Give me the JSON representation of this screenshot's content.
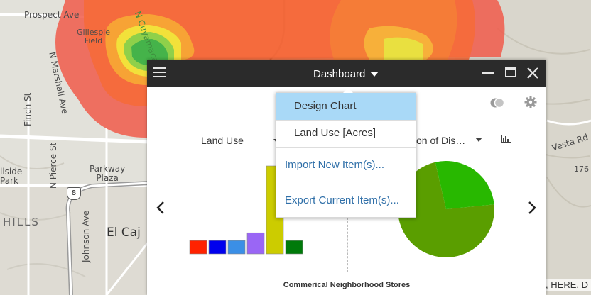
{
  "map": {
    "roads": {
      "prospect_ave": "Prospect Ave",
      "gillespie_field": "Gillespie\nField",
      "n_marshall_ave": "N Marshall Ave",
      "n_cuyamaca_st": "N Cuyamaca St",
      "finch_st": "Finch St",
      "n_pierce_st": "N Pierce St",
      "johnson_ave": "Johnson Ave",
      "parkway_plaza": "Parkway\nPlaza",
      "vesta_rd": "Vesta Rd",
      "hillside_park": "llside\nPark",
      "highway_8": "8",
      "number_176": "176"
    },
    "towns": {
      "hills": "HILLS",
      "el_cajon": "El Caj"
    },
    "attribution": ", HERE, D"
  },
  "dashboard": {
    "title": "Dashboard",
    "charts": {
      "left_title": "Land Use",
      "right_title": "on of Dis…",
      "footer": "Commerical Neighborhood Stores"
    },
    "menu": {
      "items": [
        "Design Chart",
        "Land Use [Acres]",
        "Import New Item(s)...",
        "Export Current Item(s)..."
      ]
    }
  },
  "chart_data": [
    {
      "type": "bar",
      "title": "Land Use",
      "values": [
        19,
        19,
        19,
        30,
        125,
        19
      ],
      "colors": [
        "#ff2200",
        "#0000ee",
        "#3b8fe6",
        "#9a66f5",
        "#cccc00",
        "#007a0a"
      ]
    },
    {
      "type": "pie",
      "values": [
        73,
        27
      ],
      "colors": [
        "#5a9e00",
        "#28b800"
      ]
    }
  ],
  "colors": {
    "titlebar": "#2b2b2b",
    "menu_highlight": "#a9d9f7",
    "menu_link": "#2f6fa8"
  }
}
